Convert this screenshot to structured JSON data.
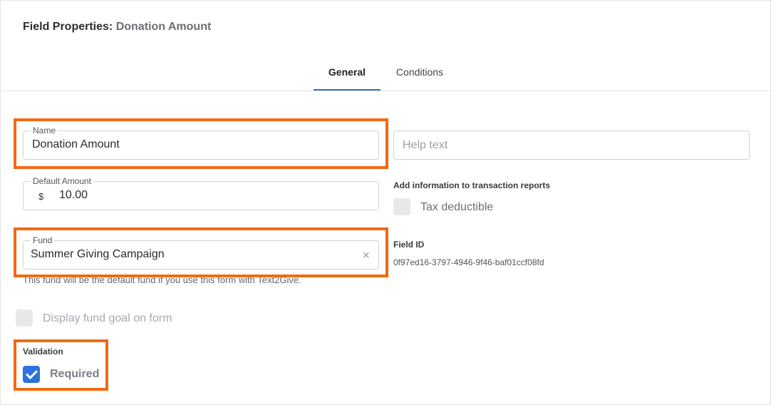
{
  "header": {
    "title_prefix": "Field Properties:",
    "title_subject": "Donation Amount"
  },
  "tabs": [
    {
      "label": "General",
      "active": true
    },
    {
      "label": "Conditions",
      "active": false
    }
  ],
  "form": {
    "name": {
      "label": "Name",
      "value": "Donation Amount"
    },
    "help_text": {
      "placeholder": "Help text",
      "value": ""
    },
    "default_amount": {
      "label": "Default Amount",
      "currency": "$",
      "value": "10.00"
    },
    "fund": {
      "label": "Fund",
      "value": "Summer Giving Campaign",
      "clear_icon": "×"
    },
    "fund_helper": "This fund will be the default fund if you use this form with Text2Give.",
    "reports_label": "Add information to transaction reports",
    "tax_deductible": {
      "label": "Tax deductible",
      "checked": false
    },
    "field_id_label": "Field ID",
    "field_id_value": "0f97ed16-3797-4946-9f46-baf01ccf08fd",
    "fund_goal": {
      "label": "Display fund goal on form",
      "checked": false
    },
    "validation_label": "Validation",
    "required": {
      "label": "Required",
      "checked": true
    }
  },
  "colors": {
    "accent": "#2b72c8",
    "highlight": "#f26a12",
    "checkbox_checked": "#2b72e0"
  },
  "icons": {
    "clear": "close-icon",
    "check": "check-icon"
  }
}
